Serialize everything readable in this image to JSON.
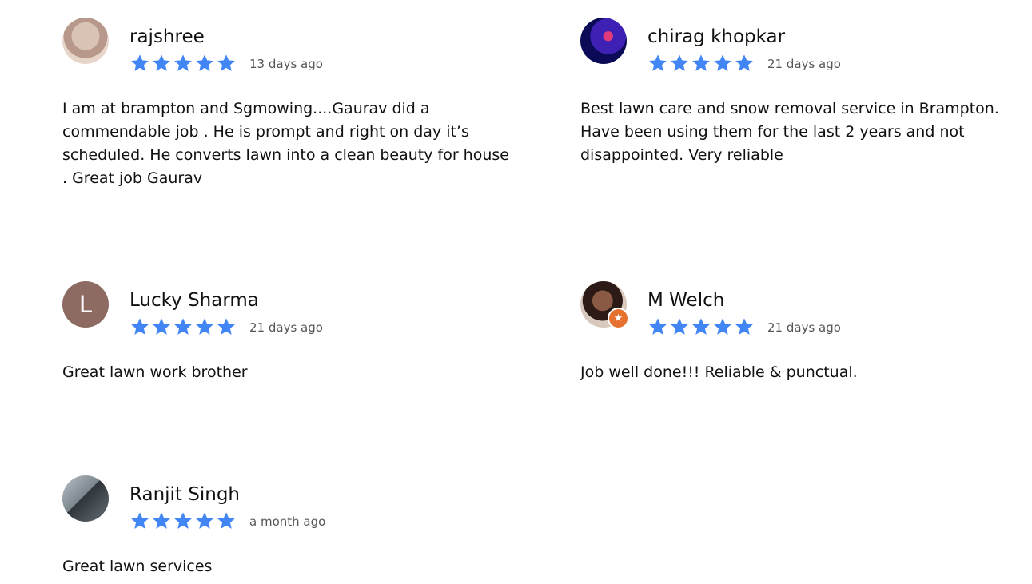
{
  "reviews": [
    {
      "name": "rajshree",
      "date": "13 days ago",
      "text": "I am at brampton and Sgmowing....Gaurav did a commendable job . He is prompt and right on day it’s scheduled. He converts lawn into a clean beauty for house . Great job Gaurav",
      "rating": 5
    },
    {
      "name": "chirag khopkar",
      "date": "21 days ago",
      "text": "Best lawn care and snow removal service in Brampton. Have been using them for the last 2 years and not disappointed. Very reliable",
      "rating": 5
    },
    {
      "name": "Lucky Sharma",
      "date": "21 days ago",
      "text": "Great lawn work brother",
      "rating": 5,
      "avatar_letter": "L"
    },
    {
      "name": "M Welch",
      "date": "21 days ago",
      "text": "Job well done!!! Reliable & punctual.",
      "rating": 5
    },
    {
      "name": "Ranjit Singh",
      "date": "a month ago",
      "text": "Great lawn services",
      "rating": 5
    }
  ],
  "colors": {
    "star": "#4285F4",
    "letter_avatar": "#8D6B63",
    "local_guide_badge": "#E6712E"
  },
  "icons": {
    "rating": "star-icon",
    "badge": "local-guide-icon"
  }
}
